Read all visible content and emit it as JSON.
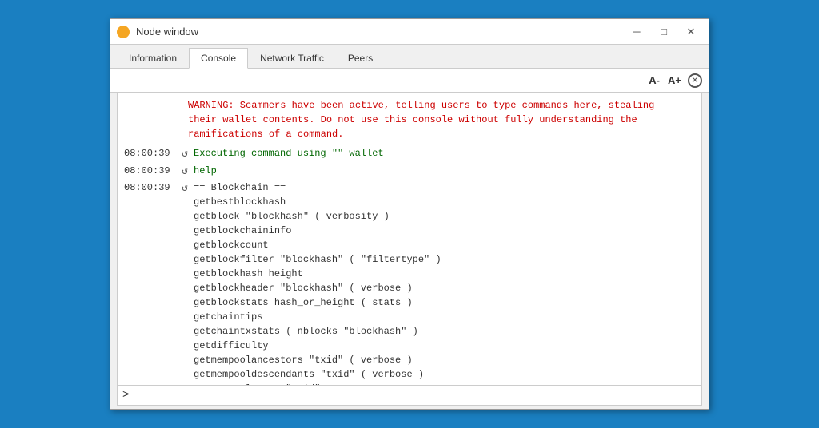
{
  "window": {
    "title": "Node window",
    "icon_color": "#f5a623"
  },
  "title_bar": {
    "minimize_label": "─",
    "maximize_label": "□",
    "close_label": "✕"
  },
  "tabs": [
    {
      "id": "information",
      "label": "Information",
      "active": false
    },
    {
      "id": "console",
      "label": "Console",
      "active": true
    },
    {
      "id": "network-traffic",
      "label": "Network Traffic",
      "active": false
    },
    {
      "id": "peers",
      "label": "Peers",
      "active": false
    }
  ],
  "toolbar": {
    "font_decrease_label": "A-",
    "font_increase_label": "A+",
    "close_icon_label": "✕"
  },
  "console": {
    "warning": "WARNING: Scammers have been active, telling users to type commands here, stealing\ntheir wallet contents. Do not use this console without fully understanding the\nramifications of a command.",
    "log_lines": [
      {
        "timestamp": "08:00:39",
        "icon": "↺",
        "text": "Executing command using \"\" wallet",
        "color": "green"
      },
      {
        "timestamp": "08:00:39",
        "icon": "↺",
        "text": "help",
        "color": "green"
      },
      {
        "timestamp": "08:00:39",
        "icon": "↺",
        "text": "== Blockchain ==\ngetbestblockhash\ngetblock \"blockhash\" ( verbosity )\ngetblockchaininfo\ngetblockcount\ngetblockfilter \"blockhash\" ( \"filtertype\" )\ngetblockhash height\ngetblockheader \"blockhash\" ( verbose )\ngetblockstats hash_or_height ( stats )\ngetchaintips\ngetchaintxstats ( nblocks \"blockhash\" )\ngetdifficulty\ngetmempoolancestors \"txid\" ( verbose )\ngetmempooldescendants \"txid\" ( verbose )\ngetmempoolentry \"txid\"\ngetmempoolinfo",
        "color": "dark"
      }
    ],
    "input_placeholder": "",
    "prompt": ">"
  }
}
